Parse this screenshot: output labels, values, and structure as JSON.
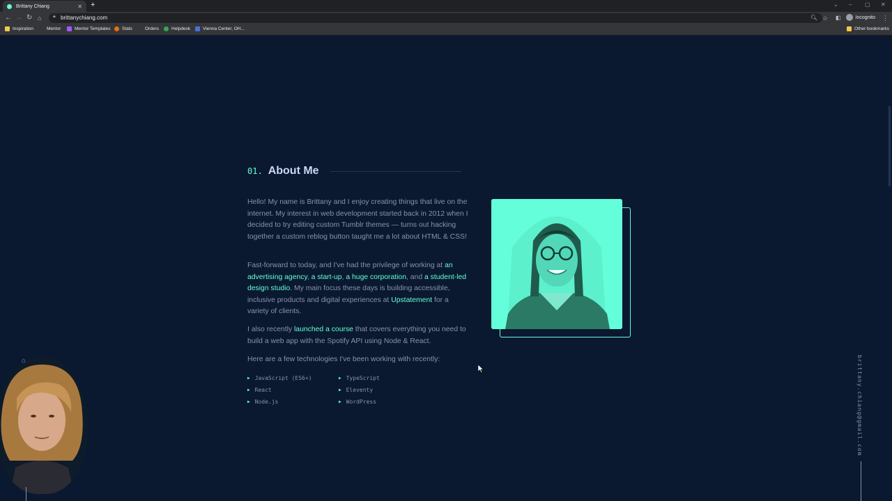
{
  "browser": {
    "tab_title": "Brittany Chiang",
    "url": "brittanychiang.com",
    "incognito_label": "Incognito",
    "bookmarks": [
      "Inspiration",
      "Mentor",
      "Mentor Templates",
      "Stats",
      "Orders",
      "Helpdesk",
      "Vienna Center, OH..."
    ],
    "other_bookmarks": "Other bookmarks"
  },
  "section": {
    "number": "01.",
    "title": "About Me"
  },
  "about": {
    "p1": "Hello! My name is Brittany and I enjoy creating things that live on the internet. My interest in web development started back in 2012 when I decided to try editing custom Tumblr themes — turns out hacking together a custom reblog button taught me a lot about HTML & CSS!",
    "p2": {
      "pre": "Fast-forward to today, and I've had the privilege of working at ",
      "link1": "an advertising agency",
      "sep1": ", ",
      "link2": "a start-up",
      "sep2": ", ",
      "link3": "a huge corporation",
      "sep3": ", and ",
      "link4": "a student-led design studio",
      "mid": ". My main focus these days is building accessible, inclusive products and digital experiences at ",
      "link5": "Upstatement",
      "post": " for a variety of clients."
    },
    "p3": {
      "pre": "I also recently ",
      "link": "launched a course",
      "post": " that covers everything you need to build a web app with the Spotify API using Node & React."
    },
    "p4": "Here are a few technologies I've been working with recently:",
    "technologies": [
      "JavaScript (ES6+)",
      "TypeScript",
      "React",
      "Eleventy",
      "Node.js",
      "WordPress"
    ]
  },
  "side_email": "brittany.chiang@gmail.com",
  "colors": {
    "background": "#0a192f",
    "accent": "#64ffda",
    "text": "#8892b0",
    "heading": "#ccd6f6"
  }
}
